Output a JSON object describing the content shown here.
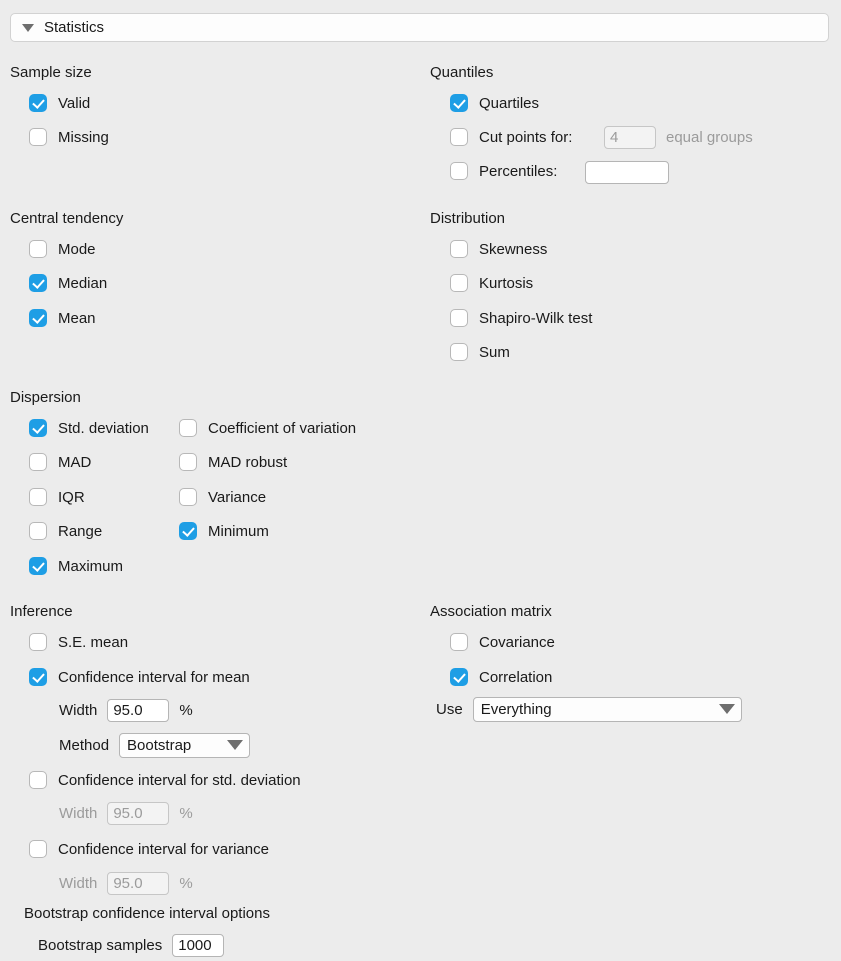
{
  "panel": {
    "title": "Statistics",
    "collapse_icon": "triangle-down-icon"
  },
  "groups": {
    "sample_size": {
      "title": "Sample size",
      "items": [
        {
          "label": "Valid",
          "checked": true
        },
        {
          "label": "Missing",
          "checked": false
        }
      ]
    },
    "quantiles": {
      "title": "Quantiles",
      "items": [
        {
          "label": "Quartiles",
          "checked": true
        },
        {
          "label": "Cut points for:",
          "checked": false
        },
        {
          "label": "Percentiles:",
          "checked": false
        }
      ],
      "cut_points_value": "4",
      "cut_points_suffix": "equal groups",
      "percentiles_value": ""
    },
    "central_tendency": {
      "title": "Central tendency",
      "items": [
        {
          "label": "Mode",
          "checked": false
        },
        {
          "label": "Median",
          "checked": true
        },
        {
          "label": "Mean",
          "checked": true
        }
      ]
    },
    "distribution": {
      "title": "Distribution",
      "items": [
        {
          "label": "Skewness",
          "checked": false
        },
        {
          "label": "Kurtosis",
          "checked": false
        },
        {
          "label": "Shapiro-Wilk test",
          "checked": false
        },
        {
          "label": "Sum",
          "checked": false
        }
      ]
    },
    "dispersion": {
      "title": "Dispersion",
      "col1": [
        {
          "label": "Std. deviation",
          "checked": true
        },
        {
          "label": "MAD",
          "checked": false
        },
        {
          "label": "IQR",
          "checked": false
        },
        {
          "label": "Range",
          "checked": false
        },
        {
          "label": "Maximum",
          "checked": true
        }
      ],
      "col2": [
        {
          "label": "Coefficient of variation",
          "checked": false
        },
        {
          "label": "MAD robust",
          "checked": false
        },
        {
          "label": "Variance",
          "checked": false
        },
        {
          "label": "Minimum",
          "checked": true
        }
      ]
    },
    "inference": {
      "title": "Inference",
      "se_mean": {
        "label": "S.E. mean",
        "checked": false
      },
      "ci_mean": {
        "label": "Confidence interval for mean",
        "checked": true
      },
      "ci_mean_width_label": "Width",
      "ci_mean_width_value": "95.0",
      "ci_mean_width_unit": "%",
      "method_label": "Method",
      "method_value": "Bootstrap",
      "ci_sd": {
        "label": "Confidence interval for std. deviation",
        "checked": false
      },
      "ci_sd_width_label": "Width",
      "ci_sd_width_value": "95.0",
      "ci_sd_width_unit": "%",
      "ci_var": {
        "label": "Confidence interval for variance",
        "checked": false
      },
      "ci_var_width_label": "Width",
      "ci_var_width_value": "95.0",
      "ci_var_width_unit": "%",
      "bootstrap_options_title": "Bootstrap confidence interval options",
      "bootstrap_samples_label": "Bootstrap samples",
      "bootstrap_samples_value": "1000"
    },
    "association_matrix": {
      "title": "Association matrix",
      "items": [
        {
          "label": "Covariance",
          "checked": false
        },
        {
          "label": "Correlation",
          "checked": true
        }
      ],
      "use_label": "Use",
      "use_value": "Everything"
    }
  },
  "colors": {
    "background": "#ececec",
    "accent_checked": "#1e9ee5",
    "text": "#1a1a1a",
    "text_disabled": "#9b9b9b",
    "field_border": "#b5b5b5"
  }
}
